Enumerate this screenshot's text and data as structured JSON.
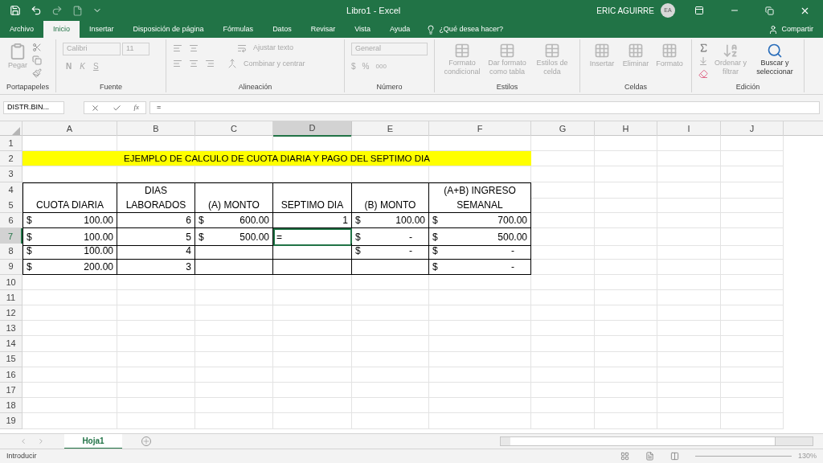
{
  "title_bar": {
    "document": "Libro1  -  Excel",
    "user": "ERIC AGUIRRE",
    "avatar": "EA"
  },
  "ribbon_tabs": [
    {
      "label": "Archivo",
      "selected": false
    },
    {
      "label": "Inicio",
      "selected": true
    },
    {
      "label": "Insertar",
      "selected": false
    },
    {
      "label": "Disposición de página",
      "selected": false
    },
    {
      "label": "Fórmulas",
      "selected": false
    },
    {
      "label": "Datos",
      "selected": false
    },
    {
      "label": "Revisar",
      "selected": false
    },
    {
      "label": "Vista",
      "selected": false
    },
    {
      "label": "Ayuda",
      "selected": false
    }
  ],
  "tell_me": "¿Qué desea hacer?",
  "share": "Compartir",
  "ribbon": {
    "clipboard": {
      "paste": "Pegar",
      "label": "Portapapeles"
    },
    "font": {
      "name": "Calibri",
      "size": "11",
      "bold": "N",
      "italic": "K",
      "underline": "S",
      "label": "Fuente"
    },
    "alignment": {
      "wrap": "Ajustar texto",
      "merge": "Combinar y centrar",
      "label": "Alineación"
    },
    "number": {
      "format": "General",
      "currency": "$",
      "percent": "%",
      "thousands": "000",
      "label": "Número"
    },
    "styles": {
      "buttons": [
        "Formato condicional",
        "Dar formato como tabla",
        "Estilos de celda"
      ],
      "label": "Estilos"
    },
    "cells": {
      "buttons": [
        "Insertar",
        "Eliminar",
        "Formato"
      ],
      "label": "Celdas"
    },
    "editing": {
      "sort": "Ordenar y filtrar",
      "find": "Buscar y seleccionar",
      "label": "Edición"
    }
  },
  "formula_bar": {
    "name_box": "DISTR.BIN...",
    "function_label": "fx",
    "formula": "="
  },
  "columns": [
    {
      "label": "A",
      "selected": false
    },
    {
      "label": "B",
      "selected": false
    },
    {
      "label": "C",
      "selected": false
    },
    {
      "label": "D",
      "selected": true
    },
    {
      "label": "E",
      "selected": false
    },
    {
      "label": "F",
      "selected": false
    },
    {
      "label": "G",
      "selected": false
    },
    {
      "label": "H",
      "selected": false
    },
    {
      "label": "I",
      "selected": false
    },
    {
      "label": "J",
      "selected": false
    }
  ],
  "rows": [
    {
      "label": "1",
      "selected": false
    },
    {
      "label": "2",
      "selected": false,
      "banner": "EJEMPLO DE CALCULO DE CUOTA DIARIA Y PAGO DEL SEPTIMO DIA"
    },
    {
      "label": "3",
      "selected": false
    },
    {
      "label": "4",
      "selected": false,
      "cells": [
        null,
        {
          "kind": "label",
          "text": "DIAS"
        },
        null,
        null,
        null,
        {
          "kind": "label",
          "text": "(A+B) INGRESO"
        }
      ]
    },
    {
      "label": "5",
      "selected": false,
      "cells": [
        {
          "kind": "label",
          "text": "CUOTA DIARIA"
        },
        {
          "kind": "label",
          "text": "LABORADOS"
        },
        {
          "kind": "label",
          "text": "(A) MONTO"
        },
        {
          "kind": "label",
          "text": "SEPTIMO DIA"
        },
        {
          "kind": "label",
          "text": "(B) MONTO"
        },
        {
          "kind": "label",
          "text": "SEMANAL"
        }
      ]
    },
    {
      "label": "6",
      "selected": false,
      "cells": [
        {
          "kind": "money",
          "currency": "$",
          "text": "100.00"
        },
        {
          "kind": "number",
          "text": "6"
        },
        {
          "kind": "money",
          "currency": "$",
          "text": "600.00"
        },
        {
          "kind": "number",
          "text": "1"
        },
        {
          "kind": "money",
          "currency": "$",
          "text": "100.00"
        },
        {
          "kind": "money",
          "currency": "$",
          "text": "700.00"
        }
      ]
    },
    {
      "label": "7",
      "selected": true,
      "cells": [
        {
          "kind": "money",
          "currency": "$",
          "text": "100.00"
        },
        {
          "kind": "number",
          "text": "5"
        },
        {
          "kind": "money",
          "currency": "$",
          "text": "500.00"
        },
        {
          "kind": "entry",
          "text": "=",
          "active": true
        },
        {
          "kind": "money",
          "currency": "$",
          "text": "-"
        },
        {
          "kind": "money",
          "currency": "$",
          "text": "500.00"
        }
      ]
    },
    {
      "label": "8",
      "selected": false,
      "cells": [
        {
          "kind": "money",
          "currency": "$",
          "text": "100.00"
        },
        {
          "kind": "number",
          "text": "4"
        },
        null,
        null,
        {
          "kind": "money",
          "currency": "$",
          "text": "-"
        },
        {
          "kind": "money",
          "currency": "$",
          "text": "-"
        }
      ]
    },
    {
      "label": "9",
      "selected": false,
      "cells": [
        {
          "kind": "money",
          "currency": "$",
          "text": "200.00"
        },
        {
          "kind": "number",
          "text": "3"
        },
        null,
        null,
        null,
        {
          "kind": "money",
          "currency": "$",
          "text": "-"
        }
      ]
    },
    {
      "label": "10",
      "selected": false
    },
    {
      "label": "11",
      "selected": false
    },
    {
      "label": "12",
      "selected": false
    },
    {
      "label": "13",
      "selected": false
    },
    {
      "label": "14",
      "selected": false
    },
    {
      "label": "15",
      "selected": false
    },
    {
      "label": "16",
      "selected": false
    },
    {
      "label": "17",
      "selected": false
    },
    {
      "label": "18",
      "selected": false
    },
    {
      "label": "19",
      "selected": false
    }
  ],
  "sheet_tabs": [
    {
      "label": "Hoja1",
      "selected": true
    }
  ],
  "status_bar": {
    "mode": "Introducir",
    "zoom": "130%"
  }
}
